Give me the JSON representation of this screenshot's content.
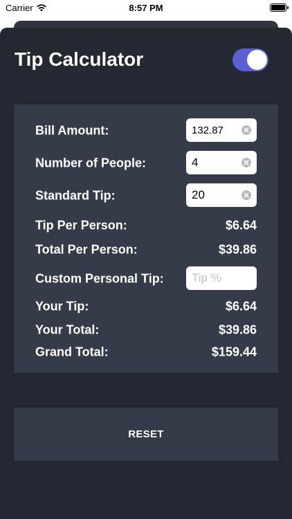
{
  "status_bar": {
    "carrier": "Carrier",
    "time": "8:57 PM",
    "wifi_icon": "wifi-icon",
    "battery_icon": "battery-icon"
  },
  "header": {
    "title": "Tip Calculator",
    "toggle_on": true,
    "toggle_color": "#5b5fd7"
  },
  "form": {
    "bill_amount_label": "Bill Amount:",
    "bill_amount_value": "132.87",
    "people_label": "Number of People:",
    "people_value": "4",
    "standard_tip_label": "Standard Tip:",
    "standard_tip_value": "20",
    "tip_per_person_label": "Tip Per Person:",
    "tip_per_person_value": "$6.64",
    "total_per_person_label": "Total Per Person:",
    "total_per_person_value": "$39.86",
    "custom_tip_label": "Custom Personal Tip:",
    "custom_tip_value": "",
    "custom_tip_placeholder": "Tip %",
    "your_tip_label": "Your Tip:",
    "your_tip_value": "$6.64",
    "your_total_label": "Your Total:",
    "your_total_value": "$39.86",
    "grand_total_label": "Grand Total:",
    "grand_total_value": "$159.44"
  },
  "actions": {
    "reset_label": "RESET"
  },
  "colors": {
    "background": "#232831",
    "card": "#353b48",
    "accent": "#5b5fd7"
  }
}
